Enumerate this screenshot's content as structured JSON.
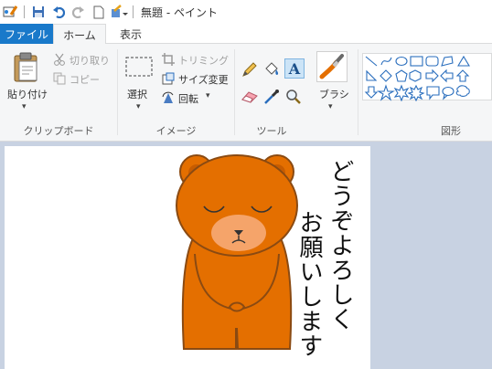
{
  "window": {
    "title": "無題 - ペイント"
  },
  "tabs": {
    "file": "ファイル",
    "home": "ホーム",
    "view": "表示"
  },
  "clipboard": {
    "paste": "貼り付け",
    "cut": "切り取り",
    "copy": "コピー",
    "group_label": "クリップボード"
  },
  "image": {
    "select": "選択",
    "crop": "トリミング",
    "resize": "サイズ変更",
    "rotate": "回転",
    "group_label": "イメージ"
  },
  "tools": {
    "group_label": "ツール",
    "items": [
      "pencil-icon",
      "fill-icon",
      "text-icon",
      "eraser-icon",
      "color-picker-icon",
      "magnifier-icon"
    ]
  },
  "brushes": {
    "label": "ブラシ"
  },
  "shapes": {
    "group_label": "図形"
  },
  "canvas": {
    "text_col1": "どうぞよろしく",
    "text_col2": "お願いします"
  },
  "colors": {
    "accent": "#1979ca",
    "bear_fur": "#e46f00",
    "bear_outline": "#8a4a12",
    "bear_muzzle": "#f5a46a",
    "workspace": "#c8d2e2"
  }
}
